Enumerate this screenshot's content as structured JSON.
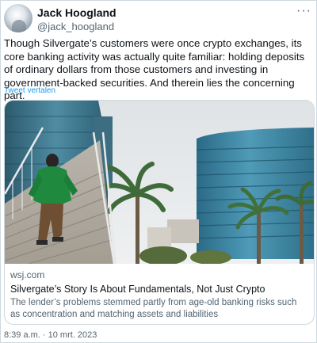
{
  "author": {
    "name": "Jack Hoogland",
    "handle": "@jack_hoogland"
  },
  "more_menu_icon": "more-dots-icon",
  "tweet_text": "Though Silvergate’s customers were once crypto exchanges, its core banking activity was actually quite familiar: holding deposits of ordinary dollars from those customers and investing in government-backed securities. And therein lies the concerning part.",
  "translate_label": "Tweet vertalen",
  "link_card": {
    "domain": "wsj.com",
    "title": "Silvergate’s Story Is About Fundamentals, Not Just Crypto",
    "description": "The lender’s problems stemmed partly from age-old banking risks such as concentration and matching assets and liabilities"
  },
  "timestamp": "8:39 a.m. · 10 mrt. 2023",
  "colors": {
    "link_blue": "#1d9bf0",
    "secondary_text": "#536471",
    "border": "#cfd9de"
  }
}
